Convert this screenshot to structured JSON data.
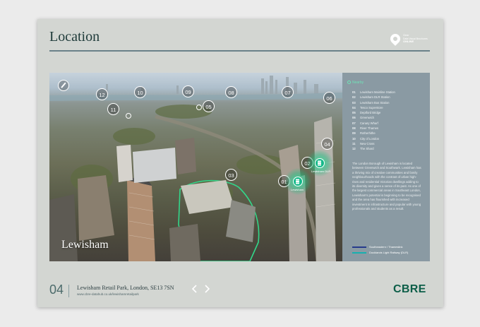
{
  "header": {
    "title": "Location",
    "logo": {
      "line1": "Clear",
      "line2": "Data Visual Brochures",
      "brand": "ONLINE"
    }
  },
  "photo": {
    "caption": "Lewisham",
    "markers": [
      "01",
      "02",
      "03",
      "04",
      "05",
      "06",
      "07",
      "08",
      "09",
      "10",
      "11",
      "12"
    ],
    "station_label": "Lewisham",
    "dlr_label": "Lewisham DLR"
  },
  "panel": {
    "heading": "Nearby",
    "legend": [
      {
        "num": "01",
        "label": "Lewisham Mainline Station"
      },
      {
        "num": "02",
        "label": "Lewisham DLR Station"
      },
      {
        "num": "03",
        "label": "Lewisham Bus Station"
      },
      {
        "num": "04",
        "label": "Tesco Superstore"
      },
      {
        "num": "05",
        "label": "Deptford Bridge"
      },
      {
        "num": "06",
        "label": "Greenwich"
      },
      {
        "num": "07",
        "label": "Canary Wharf"
      },
      {
        "num": "08",
        "label": "River Thames"
      },
      {
        "num": "09",
        "label": "Rotherhithe"
      },
      {
        "num": "10",
        "label": "City of London"
      },
      {
        "num": "11",
        "label": "New Cross"
      },
      {
        "num": "12",
        "label": "The Shard"
      }
    ],
    "body": "The London Borough of Lewisham is located between Greenwich and Southwark. Lewisham has a thriving mix of creative communities and family neighbourhoods with the contrast of urban high-rises and residential Victorian dwellings adding to its diversity and gives a sense of its past. As one of the largest commercial areas in Southeast London, Lewisham's potential is beginning to be recognised and the area has flourished with increased investment in infrastructure and popular with young professionals and students as a result.",
    "lines": [
      {
        "label": "Southeastern / Thameslink",
        "color": "#263a8c"
      },
      {
        "label": "Docklands Light Railway (DLR)",
        "color": "#17b0b0"
      }
    ]
  },
  "footer": {
    "page_number": "04",
    "title": "Lewisham Retail Park, London, SE13 7SN",
    "url": "www.cbre-datahub.co.uk/lewishamretailpark",
    "brand": "CBRE",
    "prev_icon": "chevron-left-icon",
    "next_icon": "chevron-right-icon"
  },
  "colors": {
    "accent": "#0c5e48",
    "highlight": "#6fe3b7",
    "panel": "#8a9aa3"
  }
}
